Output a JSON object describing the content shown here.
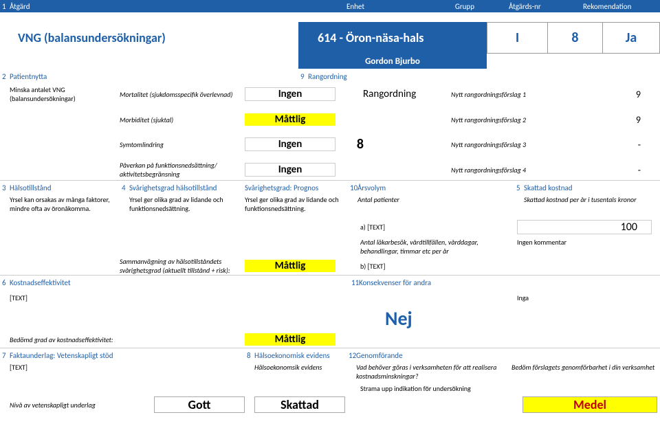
{
  "header": {
    "num": "1",
    "atgard": "Åtgärd",
    "enhet": "Enhet",
    "grupp": "Grupp",
    "atgards_nr": "Åtgärds-nr",
    "rekomendation": "Rekomendation"
  },
  "title": {
    "name": "VNG (balansundersökningar)",
    "enhet": "614 - Öron-näsa-hals",
    "grupp": "I",
    "nr": "8",
    "rec": "Ja",
    "author": "Gordon Bjurbo"
  },
  "s2": {
    "num": "2",
    "head": "Patientnytta",
    "text": "Minska antalet VNG (balansundersökningar)",
    "rows": [
      {
        "metric": "Mortalitet (sjukdomsspecifik överlevnad)",
        "val": "Ingen",
        "val_cls": "whitebig"
      },
      {
        "metric": "Morbiditet (sjuktal)",
        "val": "Måttlig",
        "val_cls": "yellow"
      },
      {
        "metric": "Symtomlindring",
        "val": "Ingen",
        "val_cls": "whitebig"
      },
      {
        "metric": "Påverkan på funktionsnedsättning/ aktivitetsbegränsning",
        "val": "Ingen",
        "val_cls": "whitebig"
      }
    ]
  },
  "s9": {
    "num": "9",
    "head": "Rangordning",
    "bigval": "8",
    "title": "Rangordning",
    "rows": [
      {
        "label": "Nytt rangordningsförslag 1",
        "val": "9"
      },
      {
        "label": "Nytt rangordningsförslag 2",
        "val": "9"
      },
      {
        "label": "Nytt rangordningsförslag 3",
        "val": "-"
      },
      {
        "label": "Nytt rangordningsförslag 4",
        "val": "-"
      }
    ]
  },
  "s3": {
    "num": "3",
    "head": "Hälsotillstånd",
    "text": "Yrsel kan orsakas av många faktorer, mindre ofta av öronåkomma."
  },
  "s4": {
    "num": "4",
    "head": "Svårighetsgrad hälsotillstånd",
    "text": "Yrsel ger olika grad av lidande och funktionsnedsättning.",
    "sum_label": "Sammanvägning av hälsotillståndets svårighetsgrad (aktuellt tillstånd + risk):",
    "sum_val": "Måttlig"
  },
  "sPrognos": {
    "head": "Svårighetsgrad: Prognos",
    "text": "Yrsel ger olika grad av lidande och funktionsnedsättning."
  },
  "s10": {
    "num": "10",
    "head": "Årsvolym",
    "sub": "Antal patienter",
    "a_label": "a) [TEXT]",
    "a_val": "100",
    "visits": "Antal läkarbesök, vårdtillfällen, vårddagar, behandlingar, timmar etc per år",
    "b_label": "b) [TEXT]"
  },
  "s5": {
    "num": "5",
    "head": "Skattad kostnad",
    "sub": "Skattad kostnad per år i tusentals kronor",
    "comm": "Ingen kommentar"
  },
  "s6": {
    "num": "6",
    "head": "Kostnadseffektivitet",
    "text": "[TEXT]",
    "bed_label": "Bedömd grad av kostnadseffektivitet:",
    "bed_val": "Måttlig"
  },
  "s11": {
    "num": "11",
    "head": "Konsekvenser för andra",
    "val": "Nej",
    "inga": "Inga"
  },
  "s7": {
    "num": "7",
    "head": "Faktaunderlag: Vetenskapligt stöd",
    "text": "[TEXT]",
    "niva_label": "Nivå av vetenskapligt underlag",
    "niva_val": "Gott"
  },
  "s8": {
    "num": "8",
    "head": "Hälsoekonomisk evidens",
    "sub": "Hälsoekonomsik evidens",
    "val": "Skattad"
  },
  "s12": {
    "num": "12",
    "head": "Genomförande",
    "q": "Vad behöver göras i verksamheten för att realisera kostnadsminskningar?",
    "a": "Strama upp indikation för undersökning",
    "bed_label": "Bedöm förslagets genomförbarhet i din verksamhet",
    "bed_val": "Medel"
  }
}
